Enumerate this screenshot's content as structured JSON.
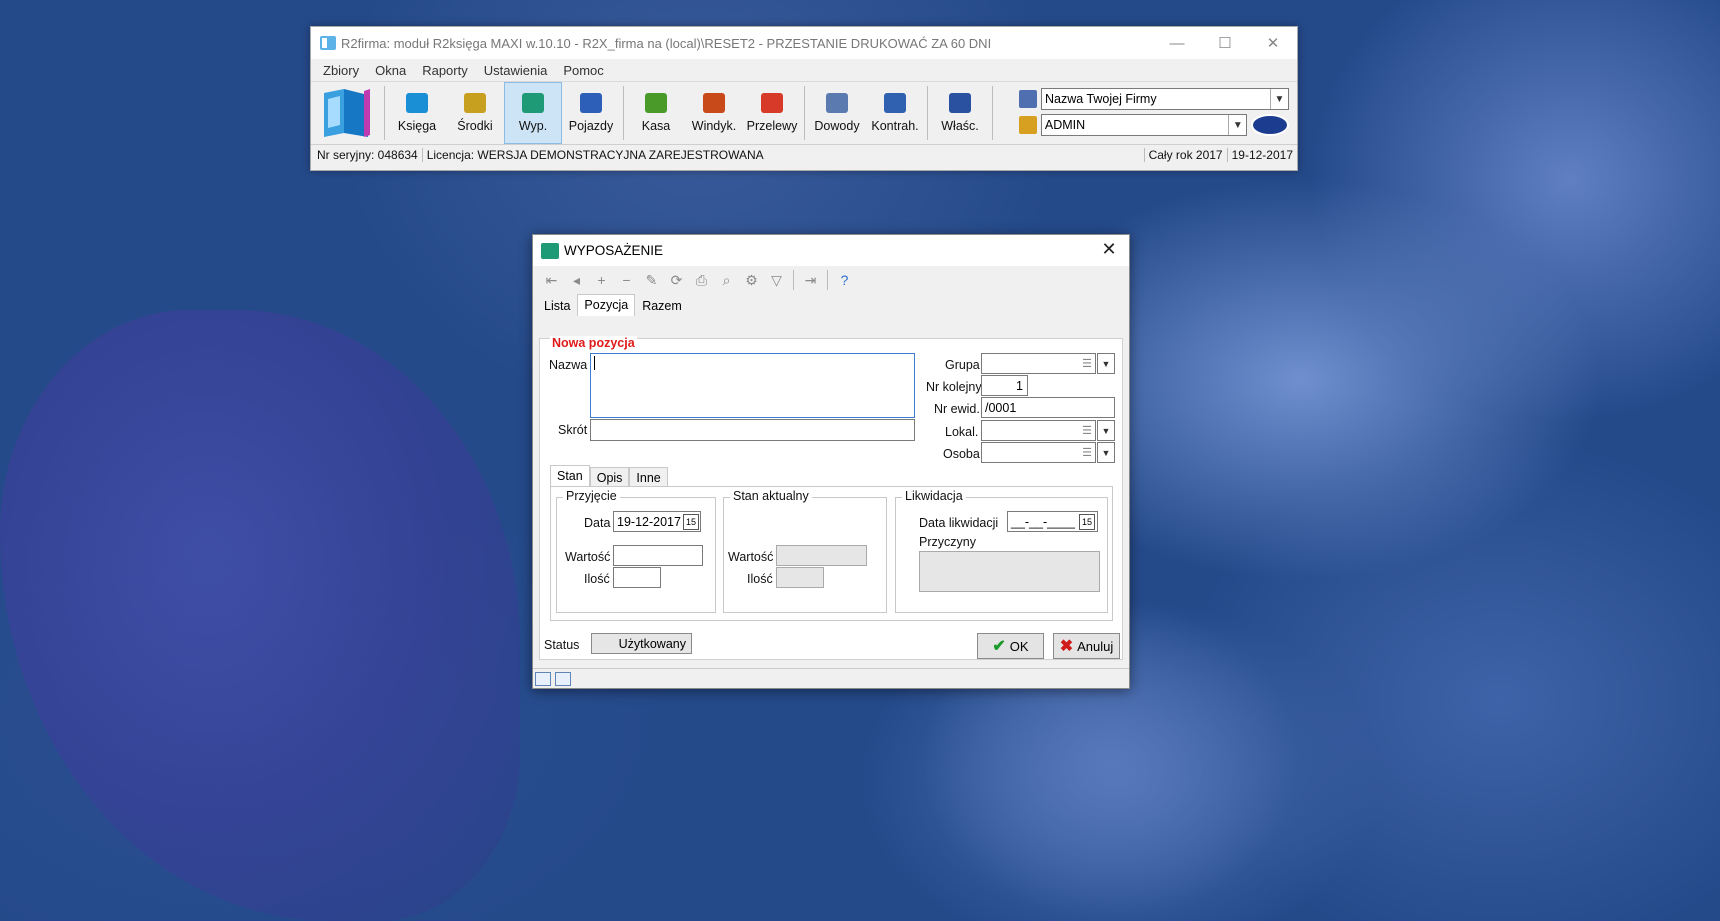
{
  "app": {
    "title": "R2firma: moduł R2księga MAXI w.10.10 - R2X_firma na (local)\\RESET2 - PRZESTANIE DRUKOWAĆ ZA 60 DNI",
    "menu": [
      "Zbiory",
      "Okna",
      "Raporty",
      "Ustawienia",
      "Pomoc"
    ],
    "toolbar_groups": [
      [
        {
          "label": "Księga",
          "icon": "book-icon",
          "color": "#1a8fd6"
        },
        {
          "label": "Środki",
          "icon": "monitor-icon",
          "color": "#c8a020"
        },
        {
          "label": "Wyp.",
          "icon": "equipment-icon",
          "color": "#1f9a77",
          "active": true
        },
        {
          "label": "Pojazdy",
          "icon": "car-icon",
          "color": "#2d5fb8"
        }
      ],
      [
        {
          "label": "Kasa",
          "icon": "cash-icon",
          "color": "#4a9a2a"
        },
        {
          "label": "Windyk.",
          "icon": "collection-icon",
          "color": "#c84a1a"
        },
        {
          "label": "Przelewy",
          "icon": "transfer-icon",
          "color": "#d83a2a"
        }
      ],
      [
        {
          "label": "Dowody",
          "icon": "documents-icon",
          "color": "#5a7ab0"
        },
        {
          "label": "Kontrah.",
          "icon": "contractors-icon",
          "color": "#3060b0"
        }
      ],
      [
        {
          "label": "Właśc.",
          "icon": "owner-icon",
          "color": "#2a50a0"
        }
      ]
    ],
    "company_combo": "Nazwa Twojej Firmy",
    "user_combo": "ADMIN",
    "status": {
      "serial": "Nr seryjny: 048634",
      "license": "Licencja: WERSJA DEMONSTRACYJNA ZAREJESTROWANA",
      "year": "Cały rok 2017",
      "date": "19-12-2017"
    }
  },
  "dialog": {
    "title": "WYPOSAŻENIE",
    "tabs": [
      "Lista",
      "Pozycja",
      "Razem"
    ],
    "section_title": "Nowa pozycja",
    "fields": {
      "nazwa_label": "Nazwa",
      "nazwa_value": "",
      "skrot_label": "Skrót",
      "skrot_value": "",
      "grupa_label": "Grupa",
      "grupa_value": "",
      "nr_kolejny_label": "Nr kolejny",
      "nr_kolejny_value": "1",
      "nr_ewid_label": "Nr ewid.",
      "nr_ewid_value": "/0001",
      "lokal_label": "Lokal.",
      "lokal_value": "",
      "osoba_label": "Osoba",
      "osoba_value": ""
    },
    "subtabs": [
      "Stan",
      "Opis",
      "Inne"
    ],
    "przyjecie": {
      "title": "Przyjęcie",
      "data_label": "Data",
      "data_value": "19-12-2017",
      "wartosc_label": "Wartość",
      "ilosc_label": "Ilość"
    },
    "stan_aktualny": {
      "title": "Stan aktualny",
      "wartosc_label": "Wartość",
      "ilosc_label": "Ilość"
    },
    "likwidacja": {
      "title": "Likwidacja",
      "data_label": "Data likwidacji",
      "data_value": "__-__-____",
      "przyczyny_label": "Przyczyny"
    },
    "status_label": "Status",
    "status_value": "Użytkowany",
    "ok_label": "OK",
    "cancel_label": "Anuluj"
  }
}
